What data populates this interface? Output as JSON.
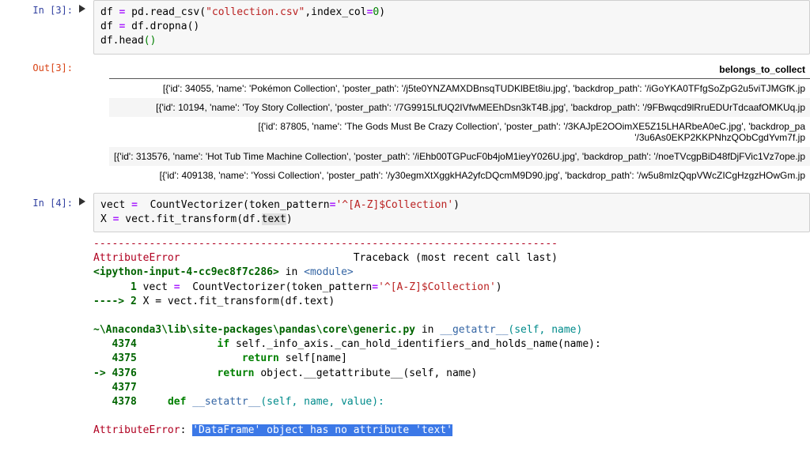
{
  "cell3": {
    "prompt_in": "In [3]:",
    "prompt_out": "Out[3]:",
    "code_line1_a": "df ",
    "code_line1_op": "=",
    "code_line1_b": " pd",
    "code_line1_dot": ".",
    "code_line1_fn": "read_csv",
    "code_line1_lp": "(",
    "code_line1_s": "\"collection.csv\"",
    "code_line1_c": ",index_col",
    "code_line1_eq": "=",
    "code_line1_n": "0",
    "code_line1_rp": ")",
    "code_line2_a": "df ",
    "code_line2_op": "=",
    "code_line2_b": " df",
    "code_line2_dot": ".",
    "code_line2_fn": "dropna",
    "code_line2_p": "()",
    "code_line3_a": "df",
    "code_line3_dot": ".",
    "code_line3_fn": "head",
    "code_line3_p": "()"
  },
  "df": {
    "column_header": "belongs_to_collect",
    "rows": [
      "[{'id': 34055, 'name': 'Pokémon Collection', 'poster_path': '/j5te0YNZAMXDBnsqTUDKlBEt8iu.jpg', 'backdrop_path': '/iGoYKA0TFfgSoZpG2u5viTJMGfK.jp",
      "[{'id': 10194, 'name': 'Toy Story Collection', 'poster_path': '/7G9915LfUQ2IVfwMEEhDsn3kT4B.jpg', 'backdrop_path': '/9FBwqcd9lRruEDUrTdcaafOMKUq.jp",
      "[{'id': 87805, 'name': 'The Gods Must Be Crazy Collection', 'poster_path': '/3KAJpE2OOimXE5Z15LHARbeA0eC.jpg', 'backdrop_pa\n'/3u6As0EKP2KKPNhzQObCgdYvm7f.jp",
      "[{'id': 313576, 'name': 'Hot Tub Time Machine Collection', 'poster_path': '/iEhb00TGPucF0b4joM1ieyY026U.jpg', 'backdrop_path': '/noeTVcgpBiD48fDjFVic1Vz7ope.jp",
      "[{'id': 409138, 'name': 'Yossi Collection', 'poster_path': '/y30egmXtXggkHA2yfcDQcmM9D90.jpg', 'backdrop_path': '/w5u8mlzQqpVWcZICgHzgzHOwGm.jp"
    ]
  },
  "cell4": {
    "prompt_in": "In [4]:",
    "l1_a": "vect ",
    "l1_op": "=",
    "l1_sp": "  ",
    "l1_fn": "CountVectorizer",
    "l1_lp": "(",
    "l1_kw": "token_pattern",
    "l1_eq": "=",
    "l1_s": "'^[A-Z]$Collection'",
    "l1_rp": ")",
    "l2_a": "X ",
    "l2_op": "=",
    "l2_b": " vect",
    "l2_d": ".",
    "l2_fn": "fit_transform",
    "l2_lp": "(",
    "l2_c": "df",
    "l2_d2": ".",
    "l2_t": "text",
    "l2_rp": ")"
  },
  "tb": {
    "dashes": "---------------------------------------------------------------------------",
    "err_header_name": "AttributeError",
    "err_header_tail": "                            Traceback (most recent call last)",
    "loc1_a": "<ipython-input-4-cc9ec8f7c286>",
    "loc1_b": " in ",
    "loc1_c": "<module>",
    "l_1_num": "      1",
    "l_1_code_a": " vect ",
    "l_1_code_op": "=",
    "l_1_code_sp": "  ",
    "l_1_code_fn": "CountVectorizer",
    "l_1_code_lp": "(",
    "l_1_code_kw": "token_pattern",
    "l_1_code_eq": "=",
    "l_1_code_s": "'^[A-Z]$Collection'",
    "l_1_code_rp": ")",
    "l_arrow": "----> ",
    "l_2_num": "2",
    "l_2_code": " X = vect.fit_transform(df.text)",
    "path2_a": "~\\Anaconda3\\lib\\site-packages\\pandas\\core\\generic.py",
    "path2_b": " in ",
    "path2_fn": "__getattr__",
    "path2_args": "(self, name)",
    "g1_num": "   4374",
    "g1_code_a": "             ",
    "g1_kw": "if",
    "g1_code_b": " self._info_axis._can_hold_identifiers_and_holds_name(name):",
    "g2_num": "   4375",
    "g2_code_a": "                 ",
    "g2_kw": "return",
    "g2_code_b": " self[name]",
    "g3_arrow": "-> ",
    "g3_num": "4376",
    "g3_code_a": "             ",
    "g3_kw": "return",
    "g3_code_b": " object.__getattribute__(self, name)",
    "g4_num": "   4377",
    "g5_num": "   4378",
    "g5_code_a": "     ",
    "g5_kw": "def",
    "g5_code_fn": " __setattr__",
    "g5_code_args": "(self, name, value):",
    "final_err": "AttributeError",
    "final_colon": ": ",
    "final_msg": "'DataFrame' object has no attribute 'text'"
  }
}
